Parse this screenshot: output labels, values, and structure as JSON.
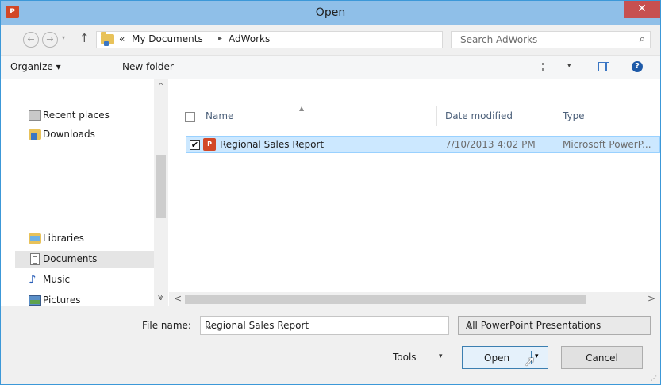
{
  "window": {
    "title": "Open",
    "app_icon": "P",
    "close_glyph": "✕"
  },
  "address": {
    "back_glyph": "←",
    "forward_glyph": "→",
    "recent_glyph": "▾",
    "up_glyph": "↑",
    "overflow_glyph": "«",
    "crumbs": [
      "My Documents",
      "AdWorks"
    ],
    "crumb_separator": "▸",
    "dropdown_glyph": "⌄",
    "refresh_glyph": "↻",
    "search_placeholder": "Search AdWorks",
    "search_glyph": "⌕"
  },
  "toolbar": {
    "organize_label": "Organize ▾",
    "new_folder_label": "New folder",
    "views_drop_glyph": "▾",
    "help_glyph": "?"
  },
  "nav": {
    "items": [
      {
        "label": "Recent places",
        "icon": "recent-places-icon"
      },
      {
        "label": "Downloads",
        "icon": "downloads-folder-icon"
      },
      {
        "label": "Libraries",
        "icon": "libraries-icon"
      },
      {
        "label": "Documents",
        "icon": "documents-icon",
        "selected": true
      },
      {
        "label": "Music",
        "icon": "music-icon"
      },
      {
        "label": "Pictures",
        "icon": "pictures-icon"
      }
    ],
    "scroll_up": "^",
    "scroll_down": "v"
  },
  "files": {
    "columns": [
      "Name",
      "Date modified",
      "Type"
    ],
    "sort_glyph": "▲",
    "rows": [
      {
        "name": "Regional Sales Report",
        "date": "7/10/2013 4:02 PM",
        "type": "Microsoft PowerP...",
        "checked": true
      }
    ],
    "check_glyph": "✔",
    "hscroll_left": "<",
    "hscroll_right": ">"
  },
  "bottom": {
    "file_name_label": "File name:",
    "file_name_value": "Regional Sales Report",
    "file_type_value": "All PowerPoint Presentations",
    "dropdown_glyph": "⌄",
    "tools_label": "Tools",
    "tools_drop": "▾",
    "open_label": "Open",
    "open_drop": "▾",
    "cancel_label": "Cancel"
  },
  "colors": {
    "title_bar": "#8fbfe8",
    "close": "#c75050",
    "selection": "#cce8ff",
    "accent": "#3c7fb1",
    "powerpoint": "#d24726"
  }
}
